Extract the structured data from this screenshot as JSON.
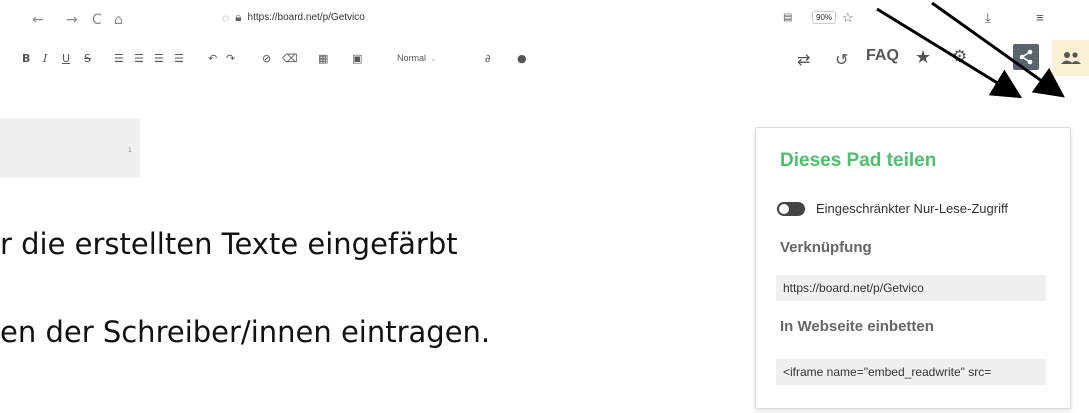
{
  "browser": {
    "back": "←",
    "forward": "→",
    "reload": "C",
    "home": "⌂",
    "url": "https://board.net/p/Getvico",
    "zoom": "90%"
  },
  "toolbar": {
    "bold": "B",
    "italic": "I",
    "underline": "U",
    "strike": "S",
    "style_select": "Normal"
  },
  "right_tools": {
    "faq": "FAQ"
  },
  "editor": {
    "line_number": "1"
  },
  "slide_text": {
    "line1": "r die erstellten Texte eingefärbt",
    "line2": "en der Schreiber/innen eintragen."
  },
  "share_panel": {
    "title": "Dieses Pad teilen",
    "toggle_label": "Eingeschränkter Nur-Lese-Zugriff",
    "toggle_on": false,
    "link_label": "Verknüpfung",
    "link_value": "https://board.net/p/Getvico",
    "embed_label": "In Webseite einbetten",
    "embed_value": "<iframe name=\"embed_readwrite\" src="
  },
  "colors": {
    "panel_title": "#4dbf6e",
    "share_button_bg": "#5a6470",
    "users_button_bg": "#fbf2d6"
  }
}
